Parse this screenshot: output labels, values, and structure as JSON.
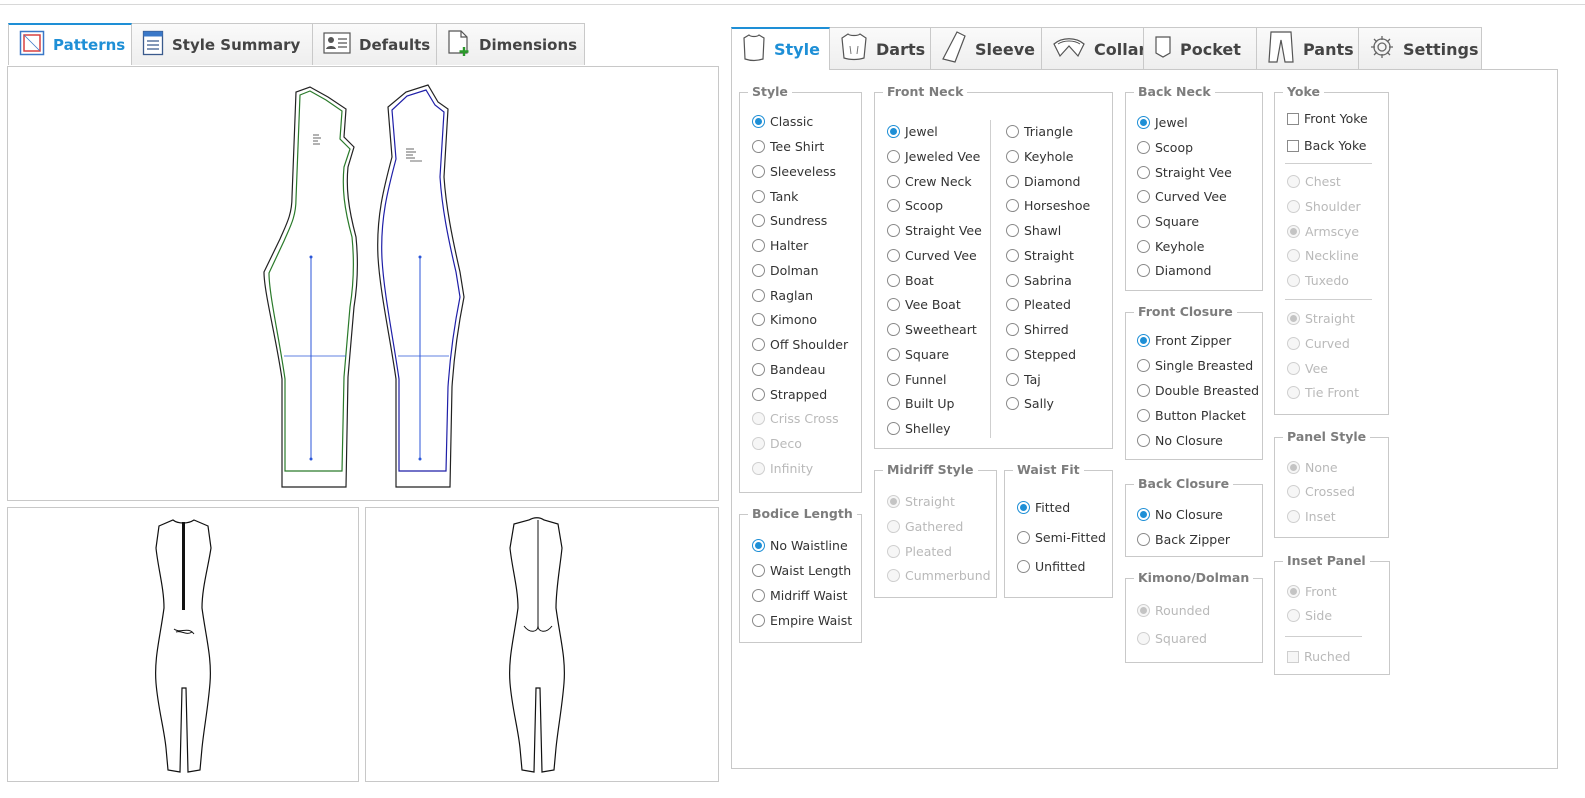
{
  "left_tabs": [
    "Patterns",
    "Style Summary",
    "Defaults",
    "Dimensions"
  ],
  "right_tabs": [
    "Style",
    "Darts",
    "Sleeve",
    "Collar",
    "Pocket",
    "Pants",
    "Settings"
  ],
  "active_left_tab": "Patterns",
  "active_right_tab": "Style",
  "accent_color": "#1e8fd6",
  "pattern_colors": {
    "front": "#2a7a2a",
    "back": "#1f1fa8",
    "grainline": "#2b56d8"
  },
  "groups": {
    "style": {
      "title": "Style",
      "options": [
        "Classic",
        "Tee Shirt",
        "Sleeveless",
        "Tank",
        "Sundress",
        "Halter",
        "Dolman",
        "Raglan",
        "Kimono",
        "Off Shoulder",
        "Bandeau",
        "Strapped",
        "Criss Cross",
        "Deco",
        "Infinity"
      ],
      "selected": "Classic",
      "disabled": [
        "Criss Cross",
        "Deco",
        "Infinity"
      ]
    },
    "bodice_length": {
      "title": "Bodice Length",
      "options": [
        "No Waistline",
        "Waist Length",
        "Midriff Waist",
        "Empire Waist"
      ],
      "selected": "No Waistline"
    },
    "front_neck": {
      "title": "Front Neck",
      "col1": [
        "Jewel",
        "Jeweled Vee",
        "Crew Neck",
        "Scoop",
        "Straight Vee",
        "Curved Vee",
        "Boat",
        "Vee Boat",
        "Sweetheart",
        "Square",
        "Funnel",
        "Built Up",
        "Shelley"
      ],
      "col2": [
        "Triangle",
        "Keyhole",
        "Diamond",
        "Horseshoe",
        "Shawl",
        "Straight",
        "Sabrina",
        "Pleated",
        "Shirred",
        "Stepped",
        "Taj",
        "Sally"
      ],
      "selected": "Jewel"
    },
    "midriff_style": {
      "title": "Midriff Style",
      "options": [
        "Straight",
        "Gathered",
        "Pleated",
        "Cummerbund"
      ],
      "selected": "Straight",
      "disabled": [
        "Straight",
        "Gathered",
        "Pleated",
        "Cummerbund"
      ]
    },
    "waist_fit": {
      "title": "Waist Fit",
      "options": [
        "Fitted",
        "Semi-Fitted",
        "Unfitted"
      ],
      "selected": "Fitted"
    },
    "back_neck": {
      "title": "Back Neck",
      "options": [
        "Jewel",
        "Scoop",
        "Straight Vee",
        "Curved Vee",
        "Square",
        "Keyhole",
        "Diamond"
      ],
      "selected": "Jewel"
    },
    "front_closure": {
      "title": "Front Closure",
      "options": [
        "Front Zipper",
        "Single Breasted",
        "Double Breasted",
        "Button Placket",
        "No Closure"
      ],
      "selected": "Front Zipper"
    },
    "back_closure": {
      "title": "Back Closure",
      "options": [
        "No Closure",
        "Back Zipper"
      ],
      "selected": "No Closure"
    },
    "kimono_dolman": {
      "title": "Kimono/Dolman",
      "options": [
        "Rounded",
        "Squared"
      ],
      "selected": "Rounded",
      "disabled": [
        "Rounded",
        "Squared"
      ]
    },
    "yoke": {
      "title": "Yoke",
      "checks": [
        "Front Yoke",
        "Back Yoke"
      ],
      "radios1": [
        "Chest",
        "Shoulder",
        "Armscye",
        "Neckline",
        "Tuxedo"
      ],
      "radios1_selected": "Armscye",
      "radios2": [
        "Straight",
        "Curved",
        "Vee",
        "Tie Front"
      ],
      "radios2_selected": "Straight"
    },
    "panel_style": {
      "title": "Panel Style",
      "options": [
        "None",
        "Crossed",
        "Inset"
      ],
      "selected": "None"
    },
    "inset_panel": {
      "title": "Inset Panel",
      "options": [
        "Front",
        "Side"
      ],
      "selected": "Front",
      "check": "Ruched"
    }
  }
}
